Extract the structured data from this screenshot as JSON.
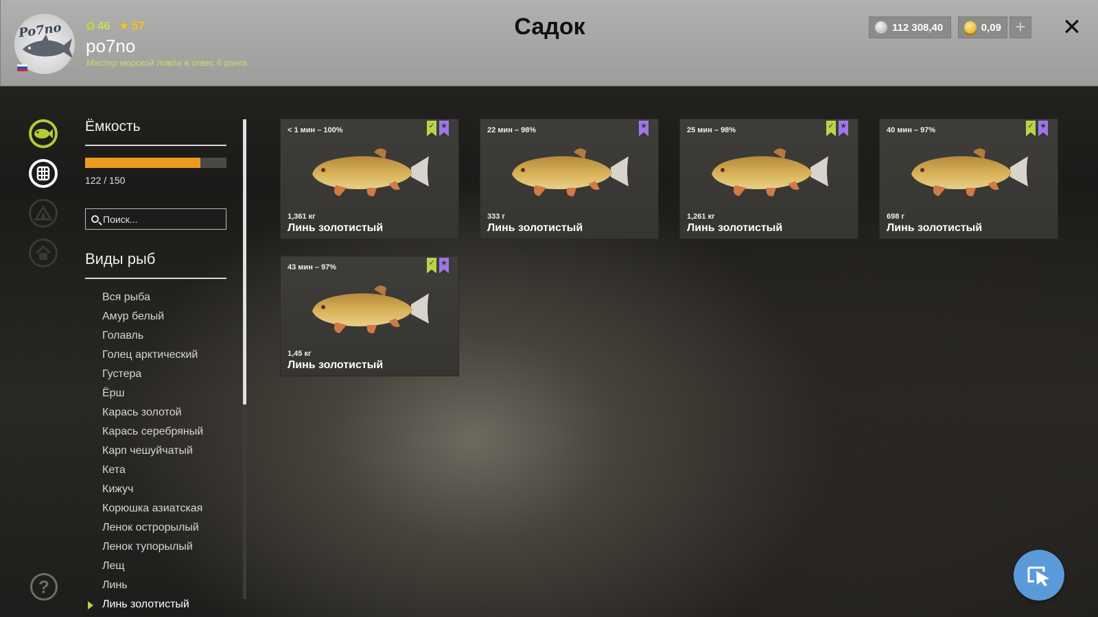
{
  "header": {
    "title": "Садок",
    "player": {
      "level": "46",
      "rank": "57",
      "name": "po7no",
      "avatar_text": "Po7no",
      "subtitle": "Мастер морской ловли в отвес 6 ранга"
    },
    "currency": {
      "silver": "112 308,40",
      "gold": "0,09",
      "add_label": "+"
    },
    "close_label": "✕"
  },
  "sidebar": {
    "capacity": {
      "title": "Ёмкость",
      "used": 122,
      "total": 150,
      "text": "122 / 150"
    },
    "search": {
      "placeholder": "Поиск..."
    },
    "species_title": "Виды рыб",
    "species": [
      "Вся рыба",
      "Амур белый",
      "Голавль",
      "Голец арктический",
      "Густера",
      "Ёрш",
      "Карась золотой",
      "Карась серебряный",
      "Карп чешуйчатый",
      "Кета",
      "Кижуч",
      "Корюшка азиатская",
      "Ленок острорылый",
      "Ленок тупорылый",
      "Лещ",
      "Линь",
      "Линь золотистый"
    ],
    "selected_species": "Линь золотистый"
  },
  "nav_icons": [
    "fish-icon",
    "keepnet-icon",
    "tent-icon",
    "home-icon"
  ],
  "help_label": "?",
  "colors": {
    "accent_green": "#b9d44a",
    "capacity_orange": "#ed9b1d",
    "badge_purple": "#9b78e6",
    "cursor_button": "#5a9ad9"
  },
  "fish_cards": [
    {
      "time": "< 1 мин – 100%",
      "weight": "1,361 кг",
      "name": "Линь золотистый",
      "badges": [
        "green",
        "purple"
      ]
    },
    {
      "time": "22 мин – 98%",
      "weight": "333 г",
      "name": "Линь золотистый",
      "badges": [
        "purple"
      ]
    },
    {
      "time": "25 мин – 98%",
      "weight": "1,261 кг",
      "name": "Линь золотистый",
      "badges": [
        "green",
        "purple"
      ]
    },
    {
      "time": "40 мин – 97%",
      "weight": "698 г",
      "name": "Линь золотистый",
      "badges": [
        "green",
        "purple"
      ]
    },
    {
      "time": "43 мин – 97%",
      "weight": "1,45 кг",
      "name": "Линь золотистый",
      "badges": [
        "green",
        "purple"
      ]
    }
  ]
}
